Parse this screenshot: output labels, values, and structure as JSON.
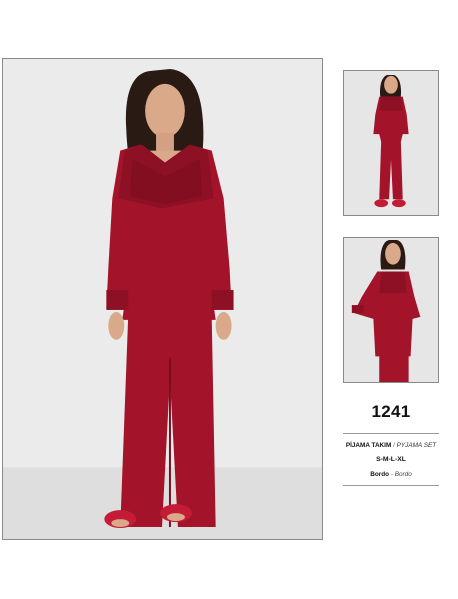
{
  "product": {
    "model_code": "1241",
    "type_tr": "PİJAMA TAKIM",
    "type_separator": "/",
    "type_en": "PYJAMA SET",
    "sizes": "S-M-L-XL",
    "color_tr": "Bordo",
    "color_separator": "-",
    "color_en": "Bordo"
  },
  "colors": {
    "garment": "#a3142a",
    "garment_dark": "#7c0d1e",
    "lace": "#8e1024",
    "skin": "#d9a98a",
    "hair": "#2a1a14",
    "background": "#e8e8e8"
  },
  "images": {
    "main": "model-front-standing",
    "thumb_1": "model-full-length",
    "thumb_2": "model-hand-on-hip"
  }
}
